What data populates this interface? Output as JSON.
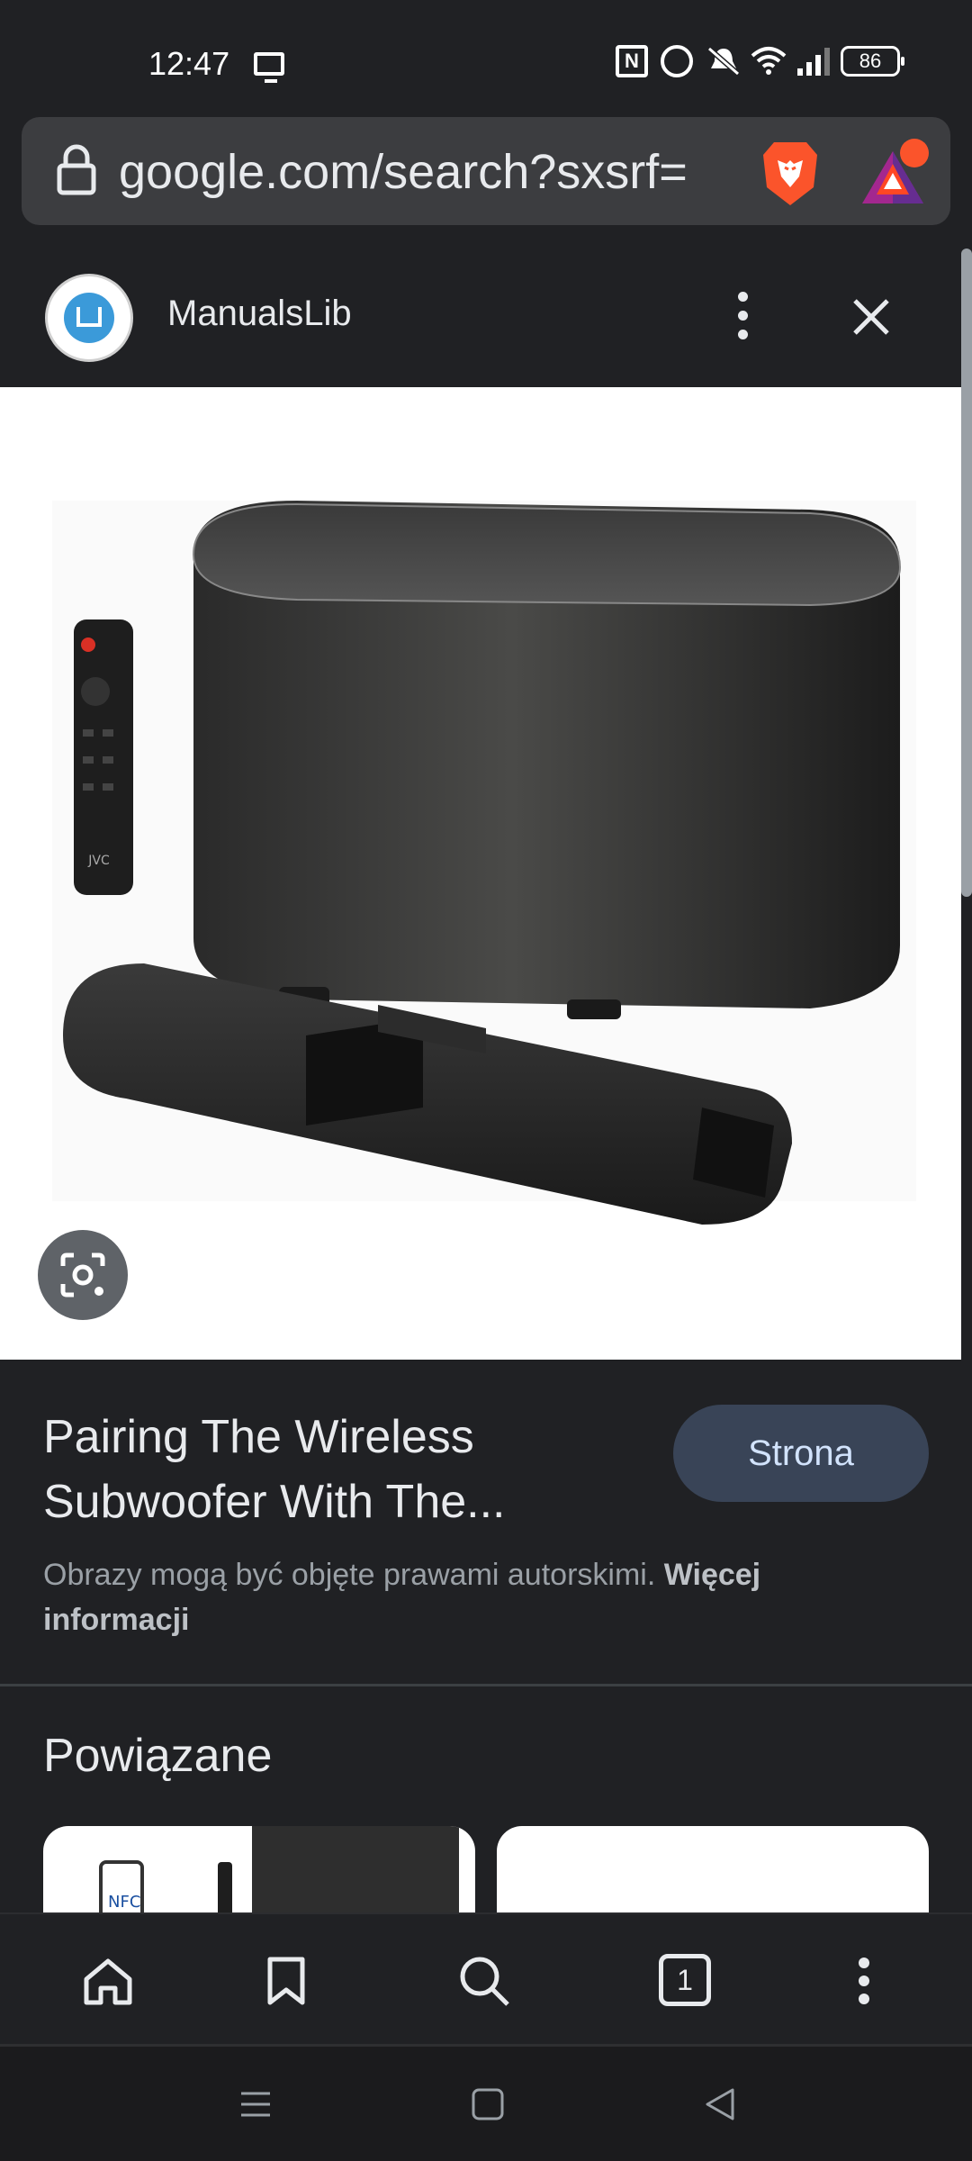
{
  "status_bar": {
    "time": "12:47",
    "battery": "86",
    "icons": [
      "cast-icon",
      "nfc-icon",
      "alarm-icon",
      "mute-icon",
      "wifi-icon",
      "signal-icon",
      "battery-icon"
    ]
  },
  "url_bar": {
    "url": "google.com/search?sxsrf="
  },
  "site": {
    "name": "ManualsLib"
  },
  "result": {
    "title": "Pairing The Wireless Subwoofer With The...",
    "page_button": "Strona",
    "copyright_text": "Obrazy mogą być objęte prawami autorskimi.",
    "more_info_link": "Więcej informacji"
  },
  "image_content": {
    "remote_brand": "JVC",
    "nfc_label": "NFC"
  },
  "related": {
    "title": "Powiązane"
  },
  "toolbar": {
    "tab_count": "1",
    "items": [
      "home-icon",
      "bookmark-icon",
      "search-icon",
      "tabs-icon",
      "menu-icon"
    ]
  },
  "colors": {
    "background": "#202124",
    "url_bar": "#3c3d40",
    "page_button": "#394457",
    "page_button_text": "#d2e3fc"
  }
}
